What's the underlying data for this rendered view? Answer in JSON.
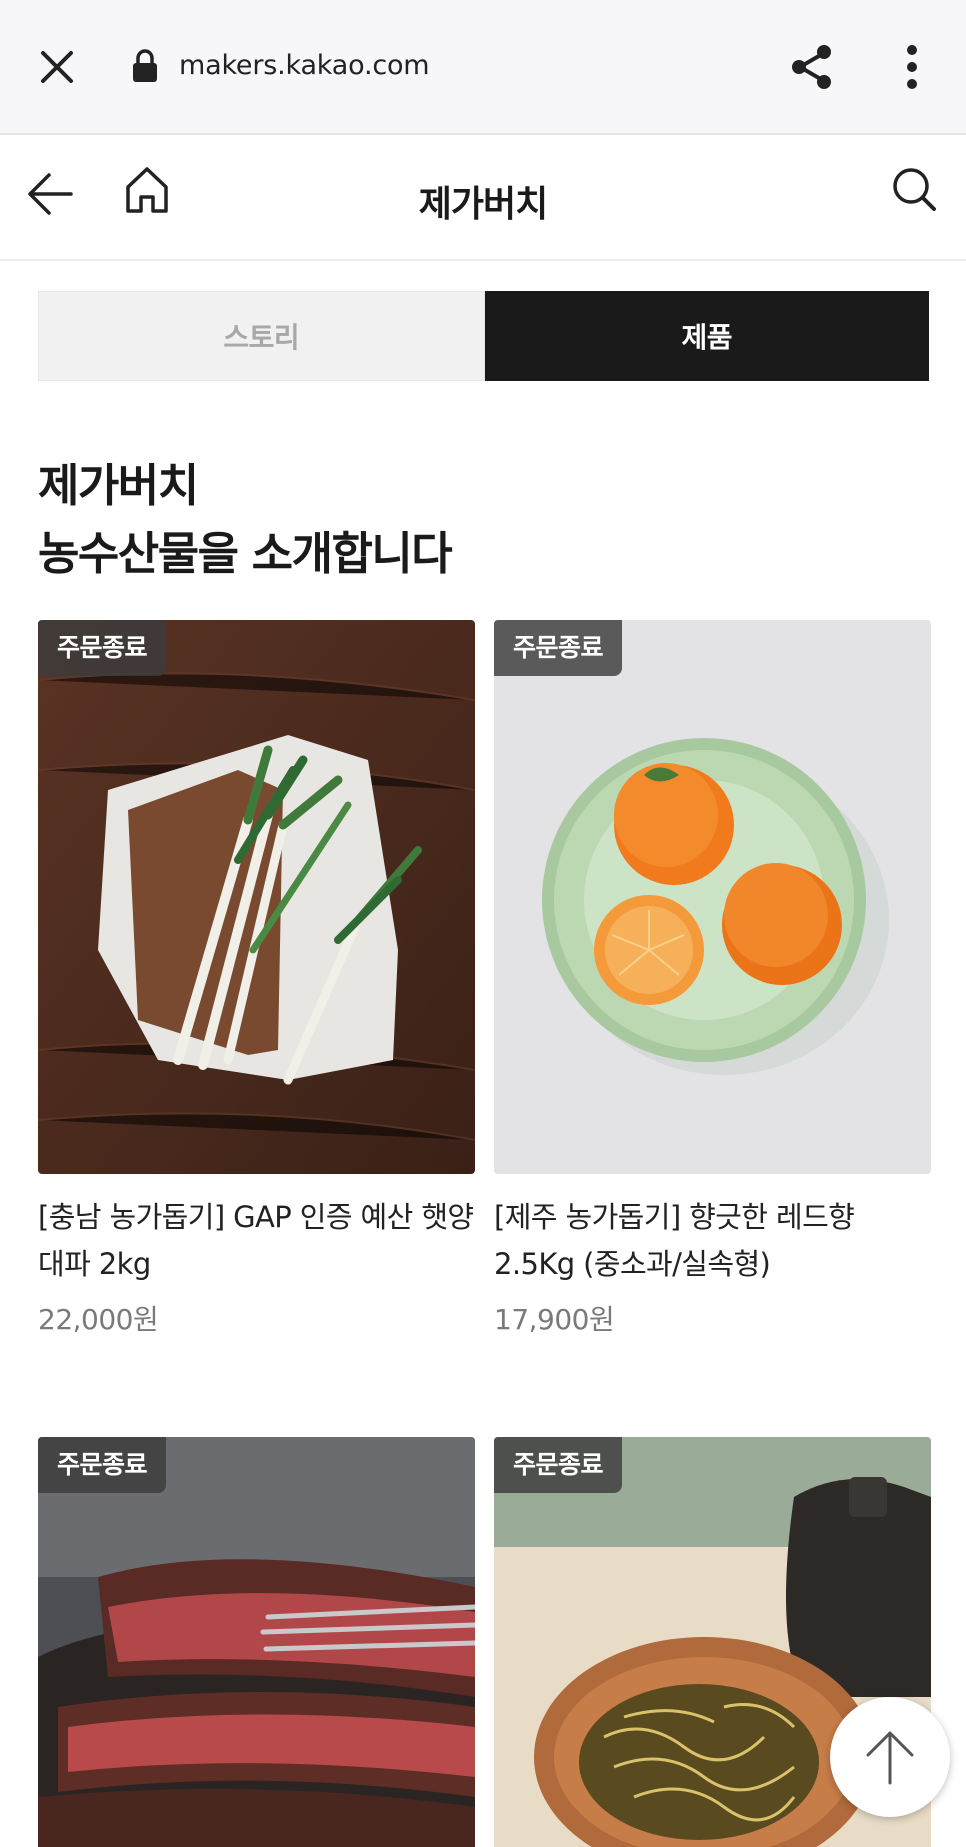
{
  "browser": {
    "url": "makers.kakao.com",
    "icons": [
      "close-icon",
      "lock-icon",
      "share-icon",
      "more-vert-icon"
    ]
  },
  "nav": {
    "title": "제가버치",
    "icons": [
      "back-arrow-icon",
      "home-icon",
      "search-icon"
    ]
  },
  "tabs": [
    {
      "label": "스토리",
      "active": false
    },
    {
      "label": "제품",
      "active": true
    }
  ],
  "heading": {
    "line1": "제가버치",
    "line2": "농수산물을 소개합니다"
  },
  "products": [
    {
      "badge": "주문종료",
      "name": "[충남 농가돕기] GAP 인증 예산 햇양대파 2kg",
      "price": "22,000원",
      "image": "green-onions"
    },
    {
      "badge": "주문종료",
      "name": "[제주 농가돕기] 향긋한 레드향 2.5Kg (중소과/실속형)",
      "price": "17,900원",
      "image": "red-hyang-tangerines"
    },
    {
      "badge": "주문종료",
      "image": "steak"
    },
    {
      "badge": "주문종료",
      "image": "pickled-greens"
    }
  ],
  "colors": {
    "activeTab": "#1a1a1a",
    "inactiveTab": "#f1f1f1",
    "price": "#7a7a7a"
  }
}
